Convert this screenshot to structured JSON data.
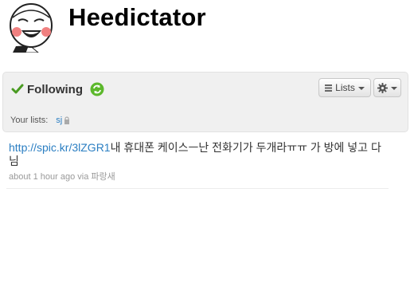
{
  "profile": {
    "name": "Heedictator",
    "avatar_icon": "cartoon-face-avatar"
  },
  "relationship": {
    "status_label": "Following",
    "status_icon": "check-icon",
    "refresh_icon": "refresh-icon",
    "lists_button_label": "Lists",
    "actions_icon": "gear-icon",
    "your_lists_label": "Your lists:",
    "lists": [
      {
        "name": "sj",
        "private": true
      }
    ]
  },
  "tweet": {
    "link": "http://spic.kr/3lZGR1",
    "text": "내 휴대폰 케이스ㅡ난 전화기가 두개라ㅠㅠ 가 방에 넣고 다님",
    "timestamp": "about 1 hour ago",
    "via_label": "via",
    "source": "파랑새"
  },
  "colors": {
    "link": "#2a7ec2",
    "check": "#4a9b22",
    "refresh": "#5cb82c",
    "panel_bg": "#f0f0f0"
  }
}
